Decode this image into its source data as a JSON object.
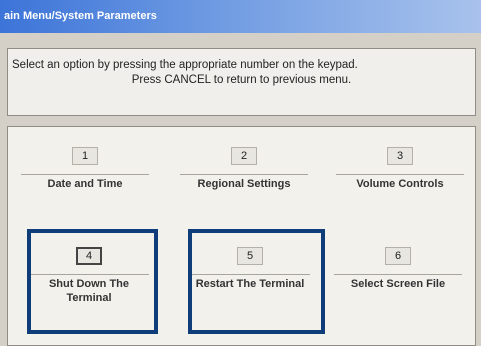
{
  "window": {
    "title": "ain Menu/System Parameters"
  },
  "instructions": {
    "line1": "Select an option by pressing the appropriate number on the keypad.",
    "line2": "Press CANCEL to return to previous menu."
  },
  "options": [
    {
      "number": "1",
      "label": "Date and Time"
    },
    {
      "number": "2",
      "label": "Regional Settings"
    },
    {
      "number": "3",
      "label": "Volume Controls"
    },
    {
      "number": "4",
      "label": "Shut Down The Terminal"
    },
    {
      "number": "5",
      "label": "Restart The Terminal"
    },
    {
      "number": "6",
      "label": "Select Screen File"
    }
  ],
  "colors": {
    "titlebar": "#3c74d8",
    "highlight": "#0f3d7a",
    "background": "#d4d0c8"
  }
}
